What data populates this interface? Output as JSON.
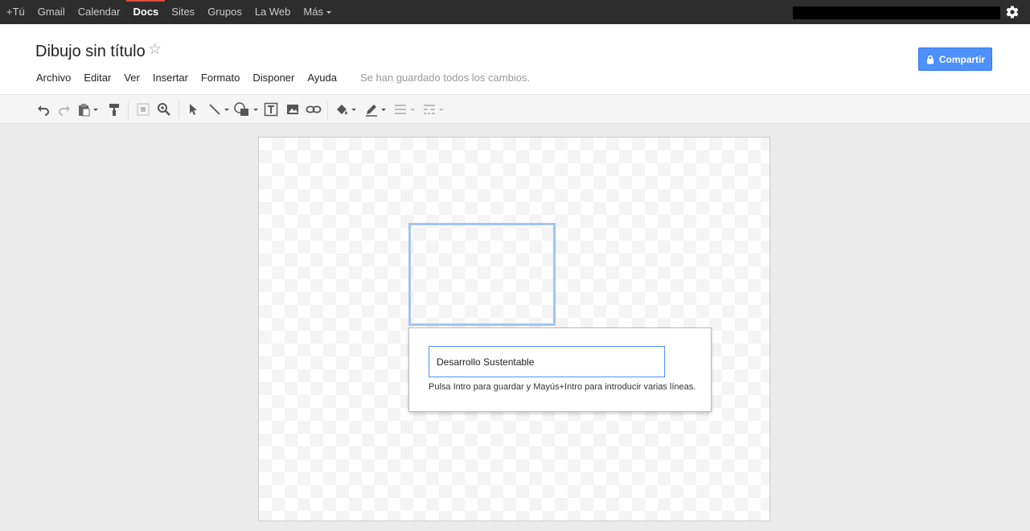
{
  "gbar": {
    "links": [
      "+Tú",
      "Gmail",
      "Calendar",
      "Docs",
      "Sites",
      "Grupos",
      "La Web",
      "Más"
    ],
    "active": "Docs"
  },
  "header": {
    "title": "Dibujo sin título",
    "menu": [
      "Archivo",
      "Editar",
      "Ver",
      "Insertar",
      "Formato",
      "Disponer",
      "Ayuda"
    ],
    "status": "Se han guardado todos los cambios.",
    "share_label": "Compartir"
  },
  "toolbar": {
    "icons": [
      "undo-icon",
      "redo-icon",
      "paste-icon",
      "paint-format-icon",
      "fit-icon",
      "zoom-icon",
      "select-icon",
      "line-icon",
      "shape-icon",
      "text-box-icon",
      "image-icon",
      "link-icon",
      "fill-color-icon",
      "line-color-icon",
      "line-weight-icon",
      "line-dash-icon"
    ]
  },
  "editor": {
    "input_value": "Desarrollo Sustentable",
    "hint": "Pulsa Intro para guardar y Mayús+Intro para introducir varias líneas."
  },
  "colors": {
    "accent": "#4d90fe",
    "top_bar": "#2d2d2d",
    "active_tab": "#dd4b39",
    "selection": "#a3c4f2"
  }
}
